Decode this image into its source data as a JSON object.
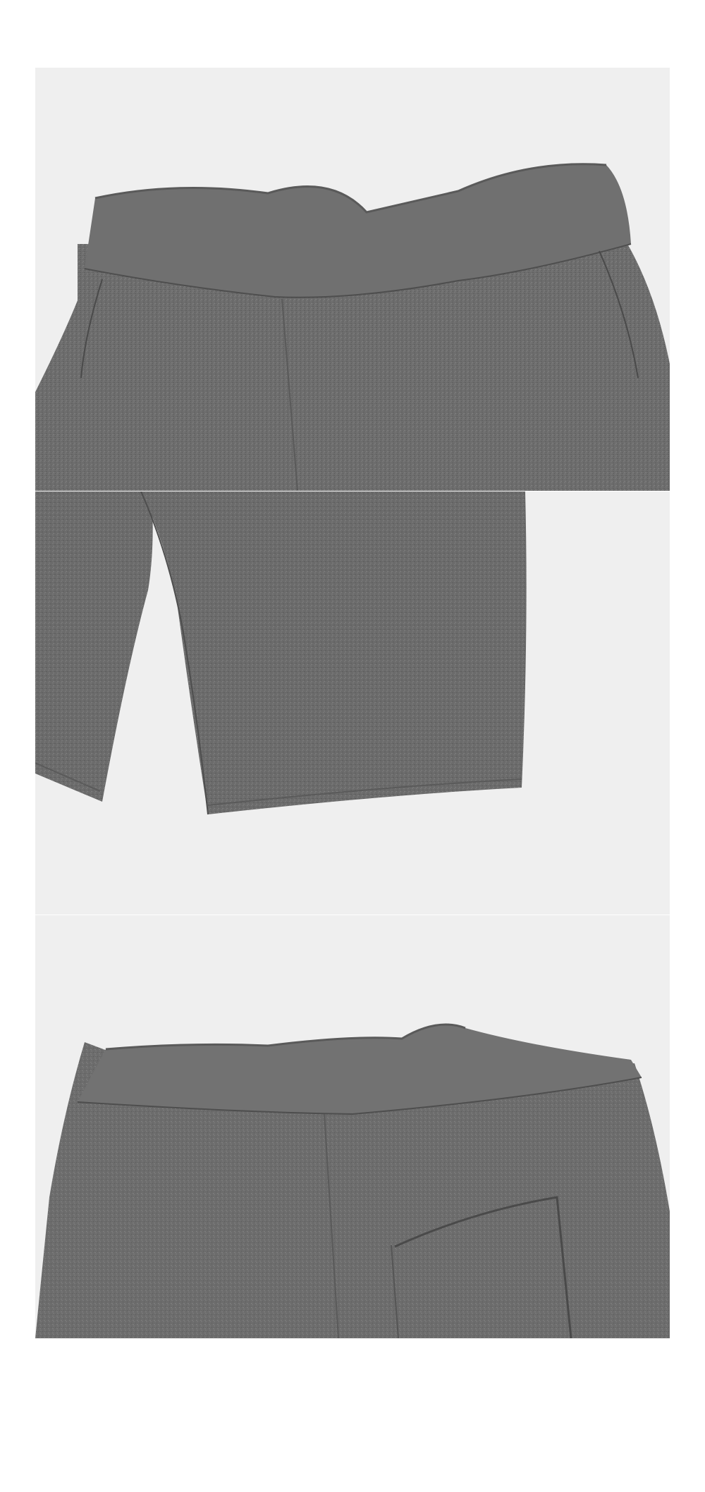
{
  "colors": {
    "background": "#ffffff",
    "panel_background": "#efefef",
    "fabric": "#6d6d6d",
    "fabric_dark": "#565656",
    "fabric_light": "#7e7e7e"
  },
  "panels": [
    {
      "subject": "waistband-front-detail"
    },
    {
      "subject": "leg-hem-detail"
    },
    {
      "subject": "back-pocket-detail"
    }
  ]
}
